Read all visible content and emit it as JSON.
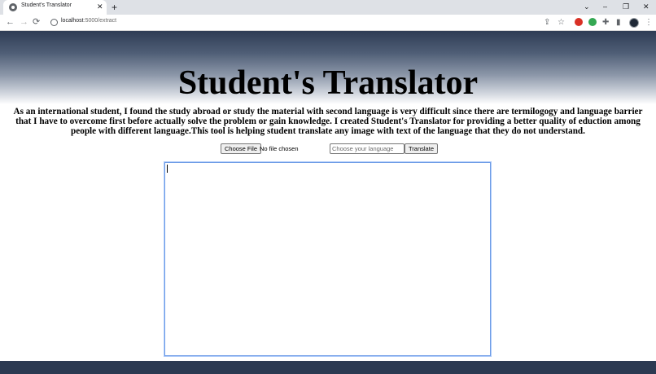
{
  "browser": {
    "tab_title": "Student's Translator",
    "tab_close": "✕",
    "new_tab": "+",
    "url_host": "localhost",
    "url_rest": ":5000/extract",
    "controls": {
      "minimize": "–",
      "restore": "❐",
      "close": "✕",
      "chevron": "⌄"
    },
    "nav": {
      "back": "←",
      "forward": "→",
      "reload": "⟳"
    },
    "toolbar_icons": {
      "share": "⇪",
      "star": "☆",
      "puzzle": "✚",
      "sidepanel": "▮",
      "menu": "⋮"
    }
  },
  "page": {
    "title": "Student's Translator",
    "description": "As an international student, I found the study abroad or study the material with second language is very difficult since there are termilogogy and language barrier that I have to overcome first before actually solve the problem or gain knowledge. I created Student's Translator for providing a better quality of eduction among people with different language.This tool is helping student translate any image with text of the language that they do not understand.",
    "file_button": "Choose File",
    "file_status": "No file chosen",
    "language_placeholder": "Choose your language",
    "translate_button": "Translate",
    "output_text": ""
  },
  "colors": {
    "header_dark": "#2f3d55",
    "footer": "#2c3a52",
    "textarea_border": "#6d9be6"
  }
}
